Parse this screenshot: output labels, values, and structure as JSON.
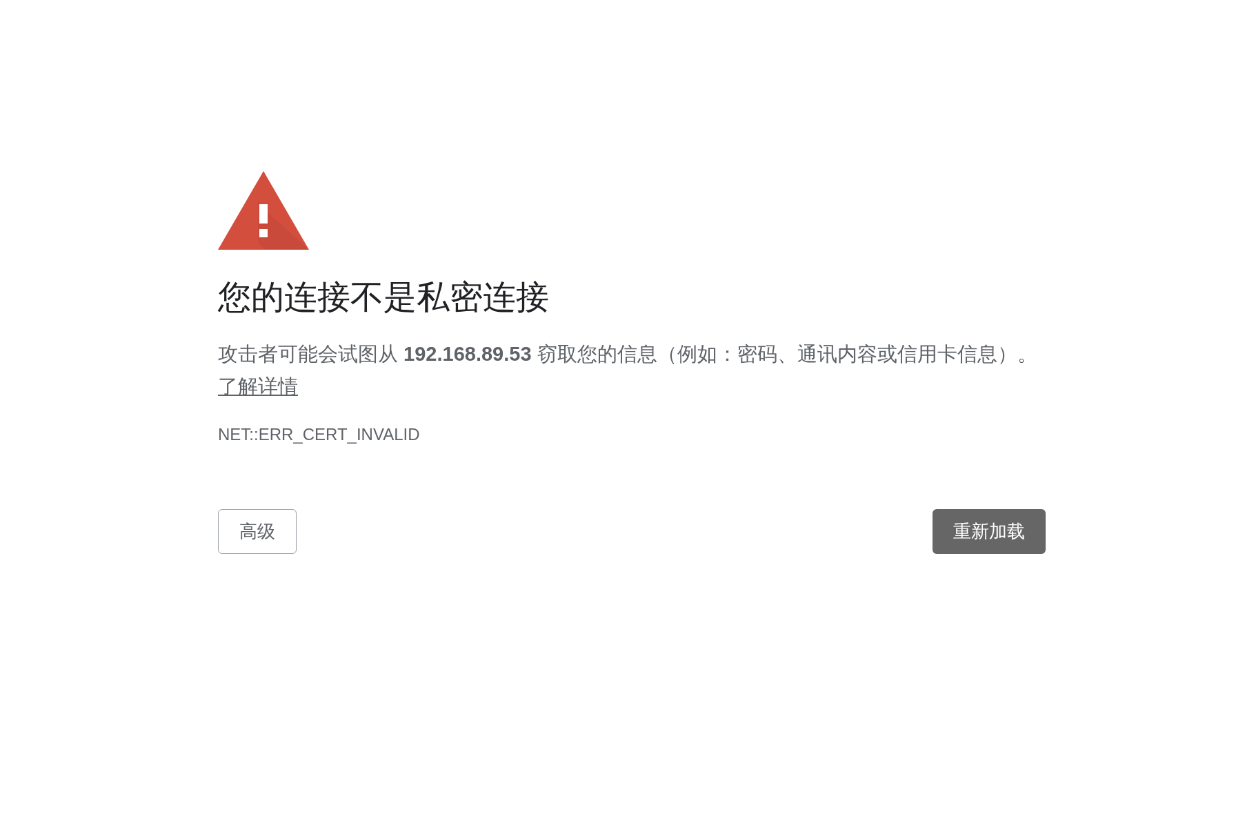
{
  "heading": "您的连接不是私密连接",
  "message": "攻击者可能会试图从 **192.168.89.53** 窃取您的信息（例如：密码、通讯内容或信用卡信息）。",
  "learn_more_link": "了解详情",
  "error_code": "NET::ERR_CERT_INVALID",
  "buttons": [
    {
      "label": "高级",
      "kind": "secondary"
    },
    {
      "label": "重新加载",
      "kind": "primary"
    }
  ]
}
